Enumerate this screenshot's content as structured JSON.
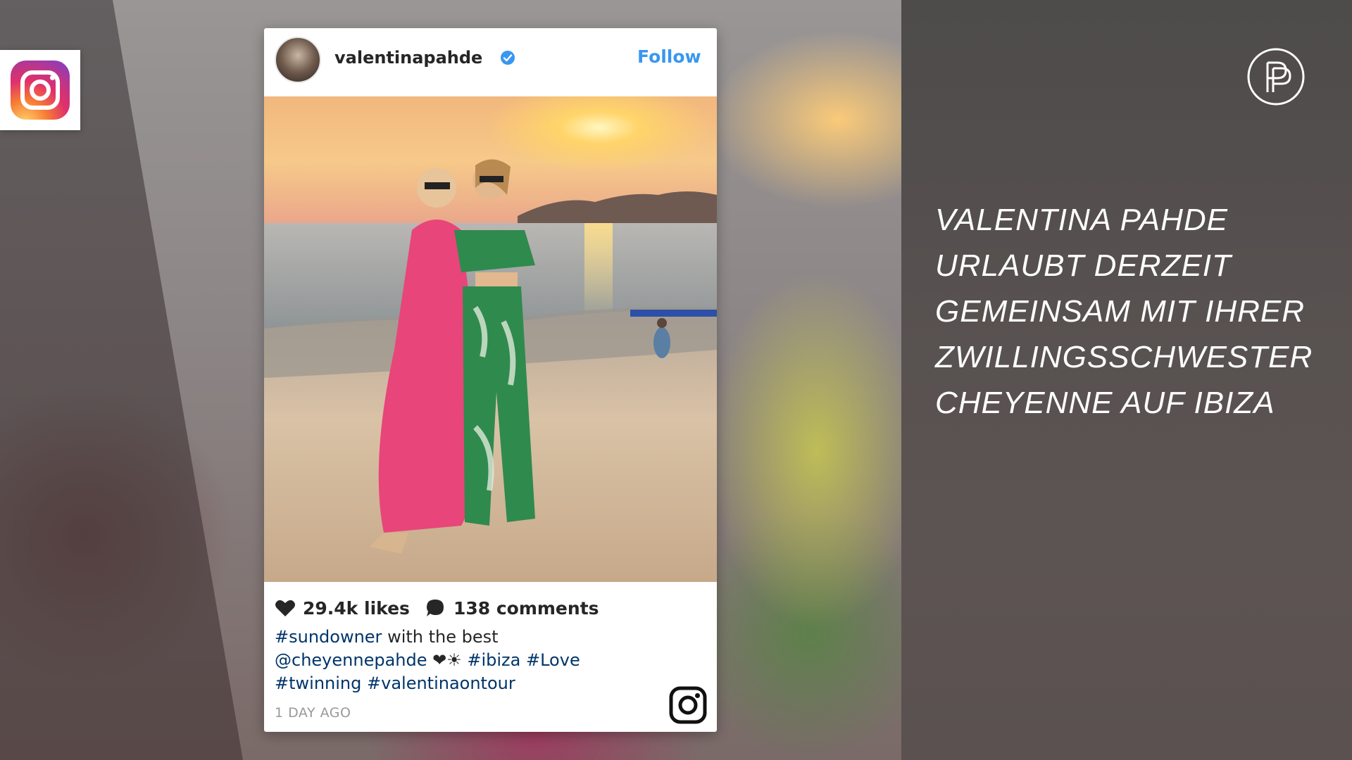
{
  "overlay": {
    "headline_lines": [
      "VALENTINA PAHDE",
      "URLAUBT DERZEIT",
      "GEMEINSAM MIT IHRER",
      "ZWILLINGSSCHWESTER",
      "CHEYENNE AUF IBIZA"
    ],
    "badge_icon": "instagram-logo",
    "monogram_icon": "broadcaster-pp-monogram"
  },
  "post": {
    "username": "valentinapahde",
    "verified": true,
    "follow_label": "Follow",
    "likes": "29.4k likes",
    "comments": "138 comments",
    "caption": {
      "line1_tag": "#sundowner",
      "line1_text": " with the best",
      "line2_mention": "@cheyennepahde",
      "line2_emoji": " ❤☀ ",
      "line2_tag1": "#ibiza",
      "line2_tag2": "#Love",
      "line3_tag1": "#twinning",
      "line3_tag2": "#valentinaontour"
    },
    "timestamp": "1 DAY AGO",
    "icons": {
      "like": "heart-icon",
      "comment": "comment-bubble-icon",
      "footer": "instagram-glyph-icon"
    }
  },
  "colors": {
    "link_blue": "#3897f0",
    "hashtag": "#003569",
    "text": "#262626",
    "muted": "#999999"
  }
}
